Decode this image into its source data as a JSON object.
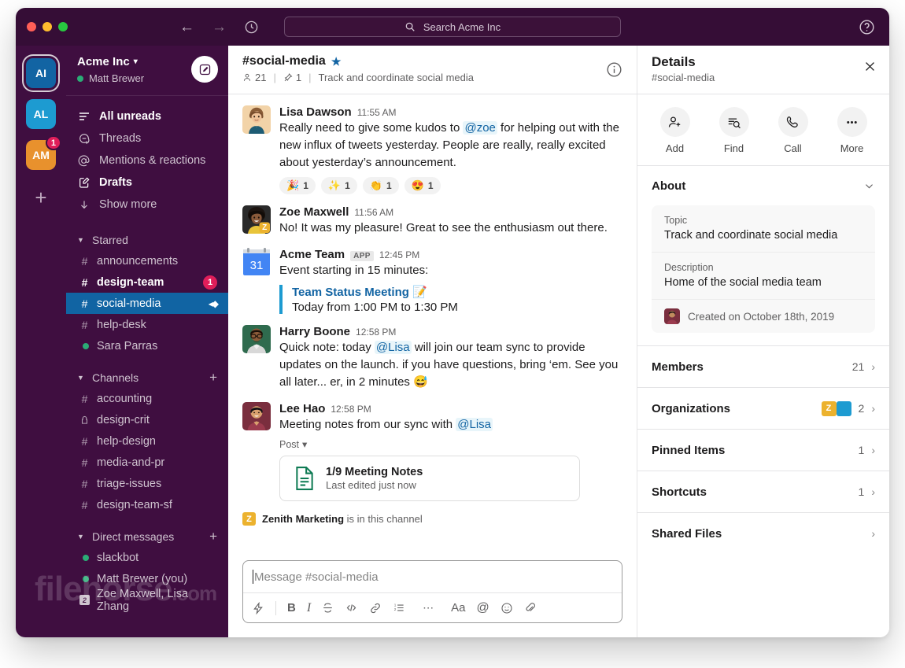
{
  "titlebar": {
    "back_icon": "arrow-left",
    "forward_icon": "arrow-right",
    "history_icon": "clock",
    "help_icon": "question-circle",
    "search_placeholder": "Search Acme Inc"
  },
  "rail": {
    "workspaces": [
      {
        "initials": "AI",
        "color": "#1264A3",
        "active": true,
        "badge": ""
      },
      {
        "initials": "AL",
        "color": "#1D9BD1",
        "active": false,
        "badge": ""
      },
      {
        "initials": "AM",
        "color": "#E8912D",
        "active": false,
        "badge": "1"
      }
    ],
    "add_label": "+"
  },
  "sidebar": {
    "workspace_name": "Acme Inc",
    "user_name": "Matt Brewer",
    "compose_icon": "compose-pencil",
    "nav": [
      {
        "label": "All unreads",
        "icon": "unreads-lines",
        "bold": true
      },
      {
        "label": "Threads",
        "icon": "threads-bubble",
        "bold": false
      },
      {
        "label": "Mentions & reactions",
        "icon": "at-sign",
        "bold": false
      },
      {
        "label": "Drafts",
        "icon": "drafts-pencil",
        "bold": true
      },
      {
        "label": "Show more",
        "icon": "arrow-down",
        "bold": false
      }
    ],
    "sections": [
      {
        "name": "Starred",
        "has_add": false,
        "items": [
          {
            "label": "announcements",
            "sym": "#",
            "state": "normal"
          },
          {
            "label": "design-team",
            "sym": "#",
            "state": "unread",
            "count": "1"
          },
          {
            "label": "social-media",
            "sym": "#",
            "state": "active",
            "share": true
          },
          {
            "label": "help-desk",
            "sym": "#",
            "state": "normal"
          },
          {
            "label": "Sara Parras",
            "sym": "dot",
            "state": "normal"
          }
        ]
      },
      {
        "name": "Channels",
        "has_add": true,
        "items": [
          {
            "label": "accounting",
            "sym": "#",
            "state": "normal"
          },
          {
            "label": "design-crit",
            "sym": "lock",
            "state": "normal"
          },
          {
            "label": "help-design",
            "sym": "#",
            "state": "normal"
          },
          {
            "label": "media-and-pr",
            "sym": "#",
            "state": "normal"
          },
          {
            "label": "triage-issues",
            "sym": "#",
            "state": "normal"
          },
          {
            "label": "design-team-sf",
            "sym": "#",
            "state": "normal"
          }
        ]
      },
      {
        "name": "Direct messages",
        "has_add": true,
        "items": [
          {
            "label": "slackbot",
            "sym": "dot",
            "state": "normal"
          },
          {
            "label": "Matt Brewer (you)",
            "sym": "dot",
            "state": "normal"
          },
          {
            "label": "Zoe Maxwell, Lisa Zhang",
            "sym": "dm2",
            "state": "normal"
          }
        ]
      }
    ]
  },
  "channel": {
    "name": "#social-media",
    "starred_icon": "star",
    "member_count": "21",
    "pin_count": "1",
    "topic": "Track and coordinate social media",
    "info_icon": "info-circle"
  },
  "messages": [
    {
      "author": "Lisa Dawson",
      "time": "11:55 AM",
      "avatar_color": "#E9C29A",
      "text_parts": [
        {
          "t": "Really need to give some kudos to ",
          "k": "plain"
        },
        {
          "t": "@zoe",
          "k": "mention"
        },
        {
          "t": " for helping out with the new influx of tweets yesterday. People are really, really excited about yesterday’s announcement.",
          "k": "plain"
        }
      ],
      "reactions": [
        {
          "emoji": "🎉",
          "count": "1"
        },
        {
          "emoji": "✨",
          "count": "1"
        },
        {
          "emoji": "👏",
          "count": "1"
        },
        {
          "emoji": "😍",
          "count": "1"
        }
      ]
    },
    {
      "author": "Zoe Maxwell",
      "time": "11:56 AM",
      "avatar_color": "#8B5A3C",
      "text_parts": [
        {
          "t": "No! It was my pleasure! Great to see the enthusiasm out there.",
          "k": "plain"
        }
      ]
    },
    {
      "author": "Acme Team",
      "time": "12:45 PM",
      "app_tag": "APP",
      "avatar_color": "#4285F4",
      "avatar_glyph": "31",
      "text_parts": [
        {
          "t": "Event starting in 15 minutes:",
          "k": "plain"
        }
      ],
      "event": {
        "title": "Team Status Meeting 📝",
        "subtitle": "Today from 1:00 PM to 1:30 PM"
      }
    },
    {
      "author": "Harry Boone",
      "time": "12:58 PM",
      "avatar_color": "#2E6B4F",
      "text_parts": [
        {
          "t": "Quick note: today ",
          "k": "plain"
        },
        {
          "t": "@Lisa",
          "k": "mention"
        },
        {
          "t": " will join our team sync to provide updates on the launch. if you have questions, bring ‘em. See you all later... er, in 2 minutes 😅",
          "k": "plain"
        }
      ]
    },
    {
      "author": "Lee Hao",
      "time": "12:58 PM",
      "avatar_color": "#7A2E3E",
      "text_parts": [
        {
          "t": "Meeting notes from our sync with ",
          "k": "plain"
        },
        {
          "t": "@Lisa",
          "k": "mention"
        }
      ],
      "post_label": "Post",
      "file": {
        "icon": "document-icon",
        "name": "1/9 Meeting Notes",
        "sub": "Last edited just now"
      }
    }
  ],
  "system_line": {
    "badge": "Z",
    "badge_color": "#ECB22E",
    "org": "Zenith Marketing",
    "rest": "is in this channel"
  },
  "composer": {
    "placeholder": "Message #social-media",
    "tools": [
      {
        "name": "shortcuts-icon",
        "glyph": "⚡"
      },
      {
        "name": "divider",
        "glyph": ""
      },
      {
        "name": "bold-icon",
        "glyph": "B"
      },
      {
        "name": "italic-icon",
        "glyph": "I"
      },
      {
        "name": "strikethrough-icon",
        "glyph": "S"
      },
      {
        "name": "code-icon",
        "glyph": "</>"
      },
      {
        "name": "link-icon",
        "glyph": "🔗"
      },
      {
        "name": "ordered-list-icon",
        "glyph": "1≡"
      },
      {
        "name": "more-icon",
        "glyph": "⋯"
      },
      {
        "name": "text-format-icon",
        "glyph": "Aa"
      },
      {
        "name": "mention-icon",
        "glyph": "@"
      },
      {
        "name": "emoji-icon",
        "glyph": "☺"
      },
      {
        "name": "attach-icon",
        "glyph": "📎"
      }
    ]
  },
  "details": {
    "title": "Details",
    "subtitle": "#social-media",
    "close_icon": "close-x",
    "actions": [
      {
        "label": "Add",
        "icon": "add-person-icon"
      },
      {
        "label": "Find",
        "icon": "find-icon"
      },
      {
        "label": "Call",
        "icon": "phone-icon"
      },
      {
        "label": "More",
        "icon": "more-dots-icon"
      }
    ],
    "about": {
      "heading": "About",
      "topic_key": "Topic",
      "topic_value": "Track and coordinate social media",
      "desc_key": "Description",
      "desc_value": "Home of the social media team",
      "created": "Created on October 18th, 2019"
    },
    "rows": [
      {
        "label": "Members",
        "value": "21",
        "orgs": []
      },
      {
        "label": "Organizations",
        "value": "2",
        "orgs": [
          {
            "initials": "Z",
            "color": "#ECB22E"
          },
          {
            "initials": "",
            "color": "#1D9BD1"
          }
        ]
      },
      {
        "label": "Pinned Items",
        "value": "1",
        "orgs": []
      },
      {
        "label": "Shortcuts",
        "value": "1",
        "orgs": []
      },
      {
        "label": "Shared Files",
        "value": "",
        "orgs": []
      }
    ]
  },
  "watermark": {
    "main": "filehorse",
    "suffix": ".com"
  }
}
